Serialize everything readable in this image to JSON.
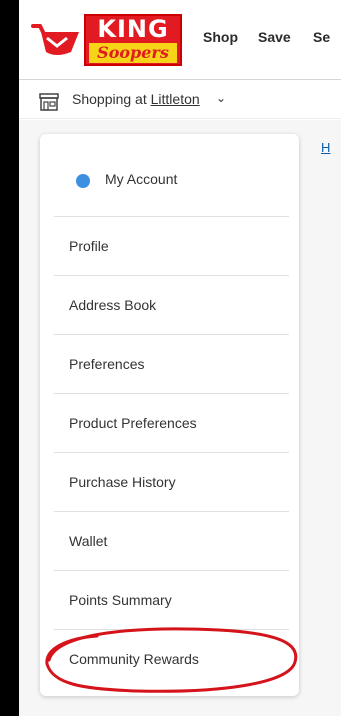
{
  "header": {
    "logo": {
      "word1": "KING",
      "word2": "Soopers"
    },
    "nav": [
      "Shop",
      "Save",
      "Se"
    ]
  },
  "store": {
    "prefix": "Shopping at",
    "location": "Littleton"
  },
  "breadcrumb": "H",
  "account_menu": {
    "title": "My Account",
    "items": [
      {
        "label": "Profile"
      },
      {
        "label": "Address Book"
      },
      {
        "label": "Preferences"
      },
      {
        "label": "Product Preferences"
      },
      {
        "label": "Purchase History"
      },
      {
        "label": "Wallet"
      },
      {
        "label": "Points Summary"
      },
      {
        "label": "Community Rewards",
        "circled": true
      }
    ]
  },
  "colors": {
    "brand_red": "#e21a22",
    "brand_yellow": "#f7d417",
    "accent_dot": "#3d8fe0",
    "link": "#0a5ea8",
    "annotation_red": "#d5131a"
  }
}
